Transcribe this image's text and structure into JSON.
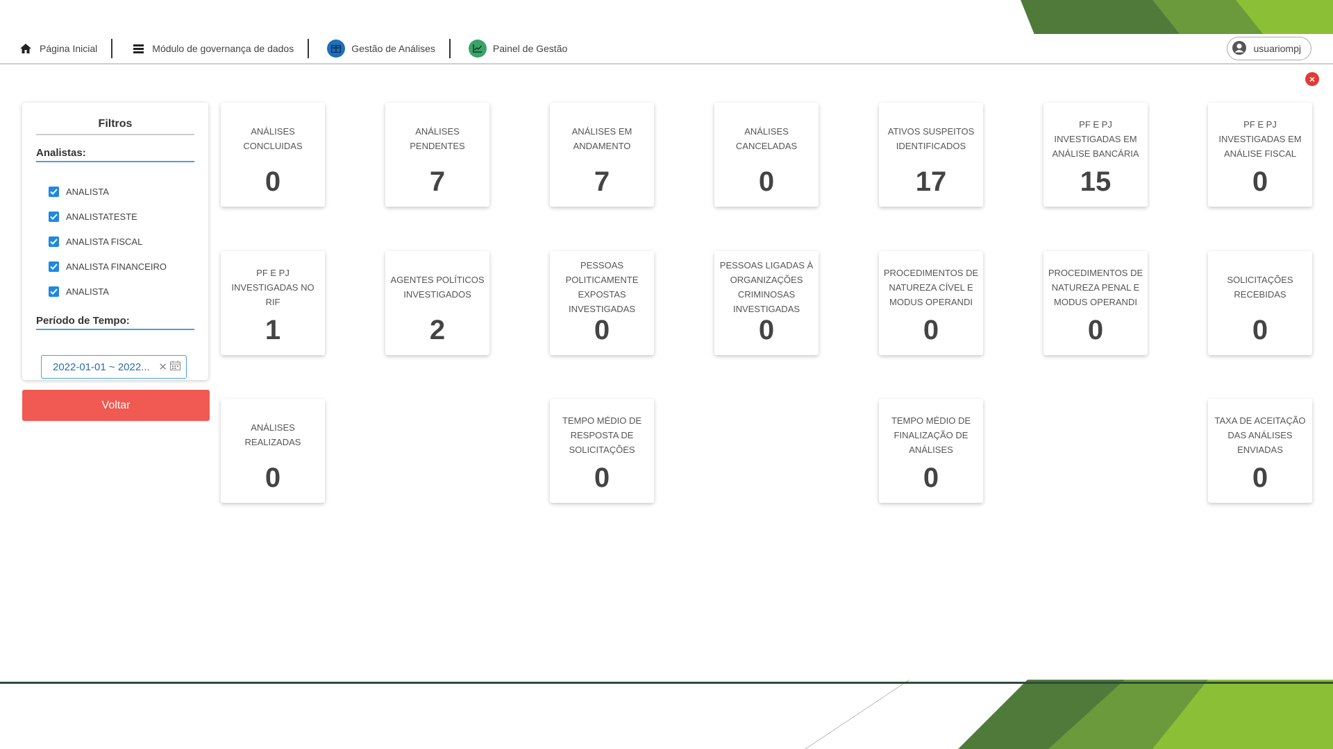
{
  "nav": {
    "items": [
      {
        "label": "Página Inicial",
        "icon": "home-icon"
      },
      {
        "label": "Módulo de governança de dados",
        "icon": "list-icon"
      },
      {
        "label": "Gestão de Análises",
        "icon": "table-icon"
      },
      {
        "label": "Painel de Gestão",
        "icon": "chart-icon"
      }
    ],
    "user": "usuariompj"
  },
  "filters": {
    "title": "Filtros",
    "analysts_label": "Analistas:",
    "analysts": [
      "ANALISTA",
      "ANALISTATESTE",
      "ANALISTA FISCAL",
      "ANALISTA FINANCEIRO",
      "ANALISTA"
    ],
    "period_label": "Período de Tempo:",
    "date_range": "2022-01-01 ~ 2022...",
    "back_button": "Voltar"
  },
  "cards": {
    "analises_concluidas": {
      "label": "ANÁLISES CONCLUIDAS",
      "value": "0"
    },
    "analises_pendentes": {
      "label": "ANÁLISES PENDENTES",
      "value": "7"
    },
    "analises_andamento": {
      "label": "ANÁLISES EM ANDAMENTO",
      "value": "7"
    },
    "analises_canceladas": {
      "label": "ANÁLISES CANCELADAS",
      "value": "0"
    },
    "ativos_suspeitos": {
      "label": "ATIVOS SUSPEITOS IDENTIFICADOS",
      "value": "17"
    },
    "pf_pj_bancaria": {
      "label": "PF E PJ INVESTIGADAS EM ANÁLISE BANCÁRIA",
      "value": "15"
    },
    "pf_pj_fiscal": {
      "label": "PF E PJ INVESTIGADAS EM ANÁLISE FISCAL",
      "value": "0"
    },
    "pf_pj_rif": {
      "label": "PF E PJ INVESTIGADAS NO RIF",
      "value": "1"
    },
    "agentes_politicos": {
      "label": "AGENTES POLÍTICOS INVESTIGADOS",
      "value": "2"
    },
    "pessoas_expostas": {
      "label": "PESSOAS POLITICAMENTE EXPOSTAS INVESTIGADAS",
      "value": "0"
    },
    "pessoas_org_criminosas": {
      "label": "PESSOAS LIGADAS À ORGANIZAÇÕES CRIMINOSAS INVESTIGADAS",
      "value": "0"
    },
    "proc_civel": {
      "label": "PROCEDIMENTOS DE NATUREZA CÍVEL E MODUS OPERANDI",
      "value": "0"
    },
    "proc_penal": {
      "label": "PROCEDIMENTOS DE NATUREZA PENAL E MODUS OPERANDI",
      "value": "0"
    },
    "solicitacoes_recebidas": {
      "label": "SOLICITAÇÕES RECEBIDAS",
      "value": "0"
    },
    "analises_realizadas": {
      "label": "ANÁLISES REALIZADAS",
      "value": "0"
    },
    "tempo_resposta": {
      "label": "TEMPO MÉDIO DE RESPOSTA DE SOLICITAÇÕES",
      "value": "0"
    },
    "tempo_finalizacao": {
      "label": "TEMPO MÉDIO DE FINALIZAÇÃO DE ANÁLISES",
      "value": "0"
    },
    "taxa_aceitacao": {
      "label": "TAXA DE ACEITAÇÃO DAS ANÁLISES ENVIADAS",
      "value": "0"
    }
  },
  "colors": {
    "accent": "#4b9fd3",
    "danger": "#f05a52",
    "check": "#1e88e5",
    "deco_green": "#7cb342"
  }
}
